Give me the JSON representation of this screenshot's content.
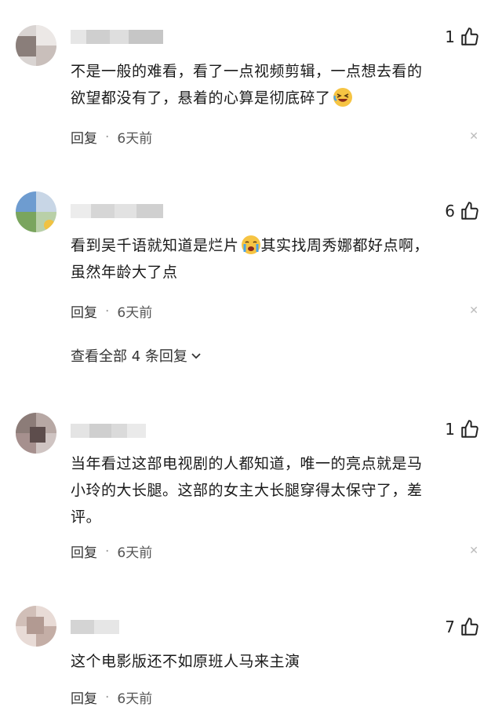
{
  "comments": [
    {
      "likes": "1",
      "text_lines": [
        "不是一般的难看，看了一点视频剪辑，一点想去看的",
        "欲望都没有了，悬着的心算是彻底碎了"
      ],
      "reply_label": "回复",
      "separator": "·",
      "time": "6天前",
      "emoji_icon": "laughing-crying-emoji"
    },
    {
      "likes": "6",
      "text_lines": [
        "看到吴千语就知道是烂片",
        "其实找周秀娜都好点啊，",
        "虽然年龄大了点"
      ],
      "reply_label": "回复",
      "separator": "·",
      "time": "6天前",
      "emoji_icon": "crying-emoji",
      "view_all_label": "查看全部 4 条回复"
    },
    {
      "likes": "1",
      "text_lines": [
        "当年看过这部电视剧的人都知道，唯一的亮点就是马",
        "小玲的大长腿。这部的女主大长腿穿得太保守了，差",
        "评。"
      ],
      "reply_label": "回复",
      "separator": "·",
      "time": "6天前"
    },
    {
      "likes": "7",
      "text_lines": [
        "这个电影版还不如原班人马来主演"
      ],
      "reply_label": "回复",
      "separator": "·",
      "time": "6天前"
    }
  ],
  "icons": {
    "like": "thumbs-up-icon",
    "close": "close-icon",
    "expand": "chevron-down-icon"
  },
  "colors": {
    "text": "#1a1a1a",
    "meta": "#555555",
    "close": "#bcbcbc"
  }
}
